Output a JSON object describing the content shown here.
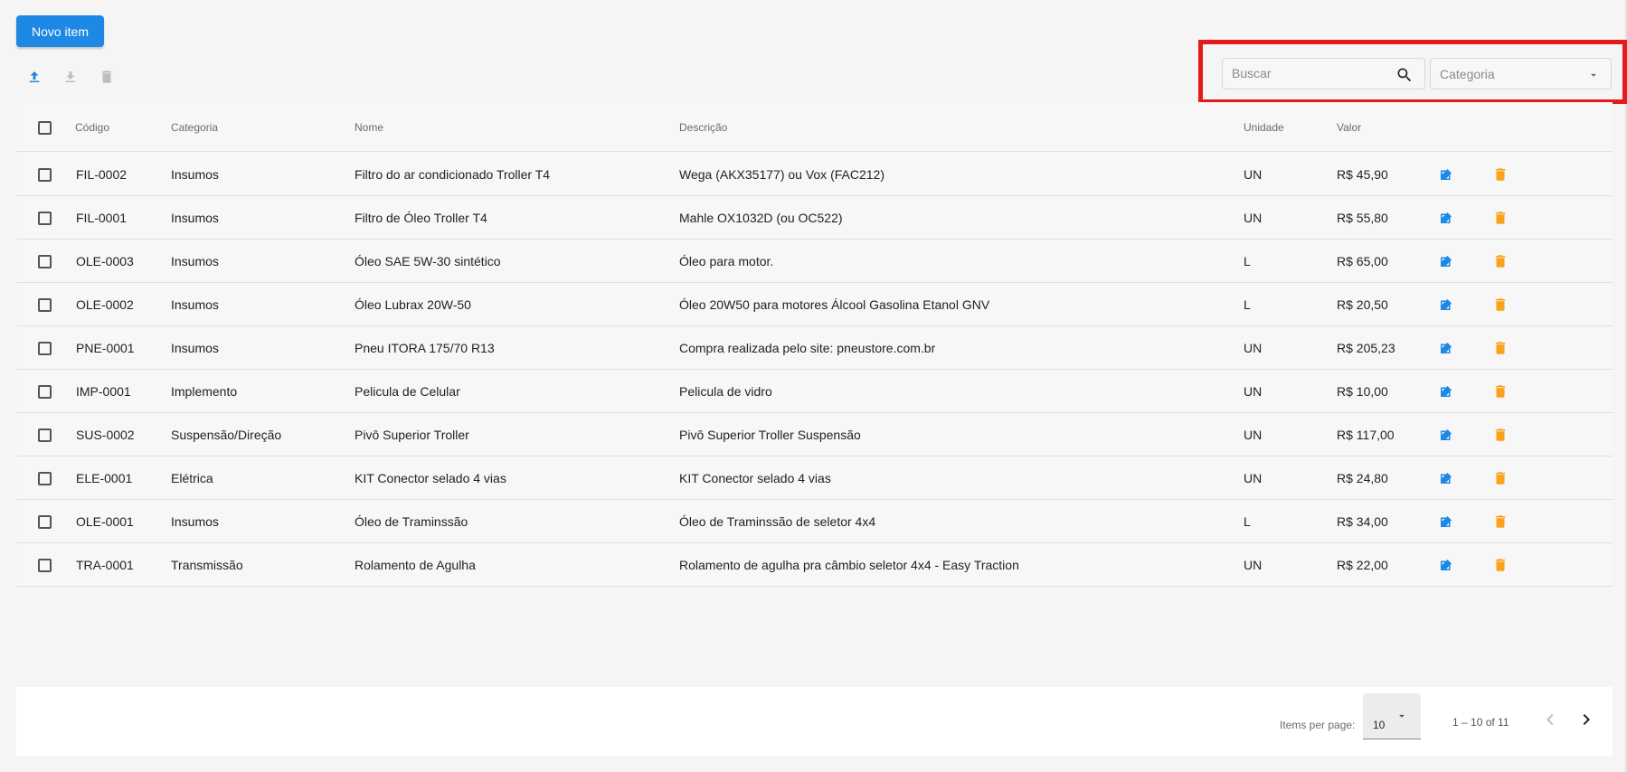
{
  "toolbar": {
    "new_item_label": "Novo item",
    "upload_icon": "upload-icon",
    "download_icon": "download-icon",
    "delete_icon": "trash-icon"
  },
  "filters": {
    "search_placeholder": "Buscar",
    "search_value": "",
    "category_selected": "Categoria"
  },
  "table": {
    "headers": {
      "code": "Código",
      "category": "Categoria",
      "name": "Nome",
      "description": "Descrição",
      "unit": "Unidade",
      "value": "Valor"
    },
    "rows": [
      {
        "code": "FIL-0002",
        "category": "Insumos",
        "name": "Filtro do ar condicionado Troller T4",
        "description": "Wega (AKX35177) ou Vox (FAC212)",
        "unit": "UN",
        "value": "R$ 45,90"
      },
      {
        "code": "FIL-0001",
        "category": "Insumos",
        "name": "Filtro de Óleo Troller T4",
        "description": "Mahle OX1032D (ou OC522)",
        "unit": "UN",
        "value": "R$ 55,80"
      },
      {
        "code": "OLE-0003",
        "category": "Insumos",
        "name": "Óleo SAE 5W-30 sintético",
        "description": "Óleo para motor.",
        "unit": "L",
        "value": "R$ 65,00"
      },
      {
        "code": "OLE-0002",
        "category": "Insumos",
        "name": "Óleo Lubrax 20W-50",
        "description": "Óleo 20W50 para motores Álcool Gasolina Etanol GNV",
        "unit": "L",
        "value": "R$ 20,50"
      },
      {
        "code": "PNE-0001",
        "category": "Insumos",
        "name": "Pneu ITORA 175/70 R13",
        "description": "Compra realizada pelo site: pneustore.com.br",
        "unit": "UN",
        "value": "R$ 205,23"
      },
      {
        "code": "IMP-0001",
        "category": "Implemento",
        "name": "Pelicula de Celular",
        "description": "Pelicula de vidro",
        "unit": "UN",
        "value": "R$ 10,00"
      },
      {
        "code": "SUS-0002",
        "category": "Suspensão/Direção",
        "name": "Pivô Superior Troller",
        "description": "Pivô Superior Troller Suspensão",
        "unit": "UN",
        "value": "R$ 117,00"
      },
      {
        "code": "ELE-0001",
        "category": "Elétrica",
        "name": "KIT Conector selado 4 vias",
        "description": "KIT Conector selado 4 vias",
        "unit": "UN",
        "value": "R$ 24,80"
      },
      {
        "code": "OLE-0001",
        "category": "Insumos",
        "name": "Óleo de Traminssão",
        "description": "Óleo de Traminssão de seletor 4x4",
        "unit": "L",
        "value": "R$ 34,00"
      },
      {
        "code": "TRA-0001",
        "category": "Transmissão",
        "name": "Rolamento de Agulha",
        "description": "Rolamento de agulha pra câmbio seletor 4x4 - Easy Traction",
        "unit": "UN",
        "value": "R$ 22,00"
      }
    ],
    "row_actions": {
      "edit_icon": "edit-icon",
      "delete_icon": "trash-icon"
    }
  },
  "paginator": {
    "items_per_page_label": "Items per page:",
    "page_size": "10",
    "range_label": "1 – 10 of 11"
  },
  "colors": {
    "primary": "#1e88e5",
    "edit": "#1e88e5",
    "delete": "#f9a21b",
    "highlight": "#e21b1b"
  }
}
